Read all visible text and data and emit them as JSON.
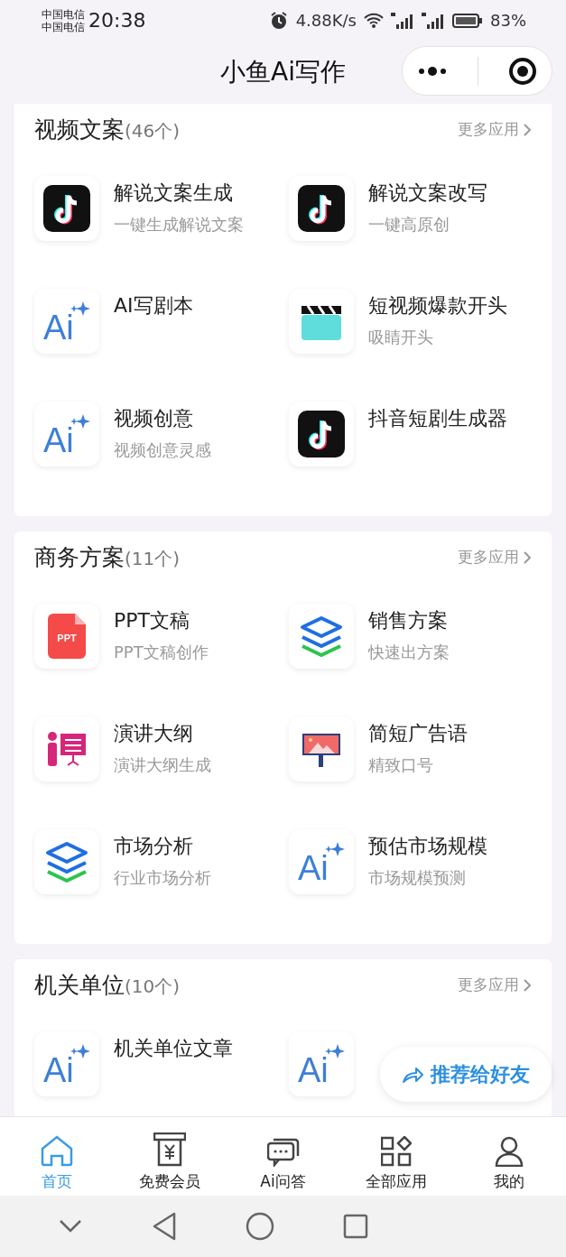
{
  "status_bar": {
    "carriers": [
      "中国电信",
      "中国电信"
    ],
    "time": "20:38",
    "speed": "4.88K/s",
    "battery": "83%"
  },
  "nav_bar": {
    "title": "小鱼Ai写作"
  },
  "sections": [
    {
      "title": "视频文案",
      "count": "(46个)",
      "more": "更多应用",
      "items": [
        {
          "kind": "tiktok",
          "title": "解说文案生成",
          "subtitle": "一键生成解说文案"
        },
        {
          "kind": "tiktok",
          "title": "解说文案改写",
          "subtitle": "一键高原创"
        },
        {
          "kind": "ai",
          "icon_text": "Ai",
          "title": "AI写剧本"
        },
        {
          "kind": "clapper",
          "title": "短视频爆款开头",
          "subtitle": "吸睛开头"
        },
        {
          "kind": "ai",
          "icon_text": "Ai",
          "title": "视频创意",
          "subtitle": "视频创意灵感"
        },
        {
          "kind": "tiktok",
          "title": "抖音短剧生成器"
        }
      ]
    },
    {
      "title": "商务方案",
      "count": "(11个)",
      "more": "更多应用",
      "items": [
        {
          "kind": "ppt",
          "icon_text": "PPT",
          "title": "PPT文稿",
          "subtitle": "PPT文稿创作"
        },
        {
          "kind": "layers",
          "title": "销售方案",
          "subtitle": "快速出方案"
        },
        {
          "kind": "presenter",
          "title": "演讲大纲",
          "subtitle": "演讲大纲生成"
        },
        {
          "kind": "billboard",
          "title": "简短广告语",
          "subtitle": "精致口号"
        },
        {
          "kind": "layers",
          "title": "市场分析",
          "subtitle": "行业市场分析"
        },
        {
          "kind": "ai",
          "icon_text": "Ai",
          "title": "预估市场规模",
          "subtitle": "市场规模预测"
        }
      ]
    },
    {
      "title": "机关单位",
      "count": "(10个)",
      "more": "更多应用",
      "items": [
        {
          "kind": "ai",
          "icon_text": "Ai",
          "title": "机关单位文章"
        },
        {
          "kind": "ai",
          "icon_text": "Ai"
        }
      ]
    }
  ],
  "share_button": {
    "label": "推荐给好友"
  },
  "tab_bar": [
    {
      "kind": "home",
      "label": "首页",
      "selected": true
    },
    {
      "kind": "ticket",
      "label": "免费会员",
      "selected": false
    },
    {
      "kind": "chat",
      "label": "Ai问答",
      "selected": false
    },
    {
      "kind": "apps",
      "label": "全部应用",
      "selected": false
    },
    {
      "kind": "user",
      "label": "我的",
      "selected": false
    }
  ]
}
